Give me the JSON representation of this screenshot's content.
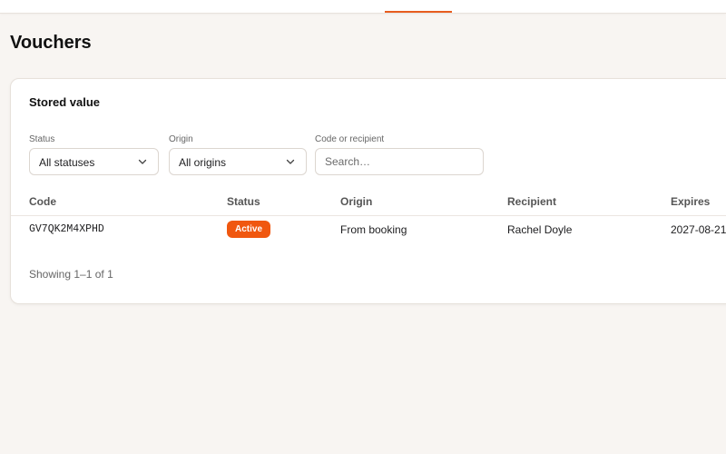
{
  "page": {
    "title": "Vouchers"
  },
  "card": {
    "title": "Stored value"
  },
  "filters": {
    "status": {
      "label": "Status",
      "value": "All statuses"
    },
    "origin": {
      "label": "Origin",
      "value": "All origins"
    },
    "search": {
      "label": "Code or recipient",
      "placeholder": "Search…",
      "value": ""
    }
  },
  "table": {
    "columns": [
      "Code",
      "Status",
      "Origin",
      "Recipient",
      "Expires"
    ],
    "rows": [
      {
        "code": "GV7QK2M4XPHD",
        "status": "Active",
        "origin": "From booking",
        "recipient": "Rachel Doyle",
        "expires": "2027-08-21"
      }
    ]
  },
  "pagination": {
    "summary": "Showing 1–1 of 1"
  },
  "colors": {
    "accent": "#f0570f",
    "nav_active": "#e85d1f",
    "background": "#f8f5f2"
  }
}
